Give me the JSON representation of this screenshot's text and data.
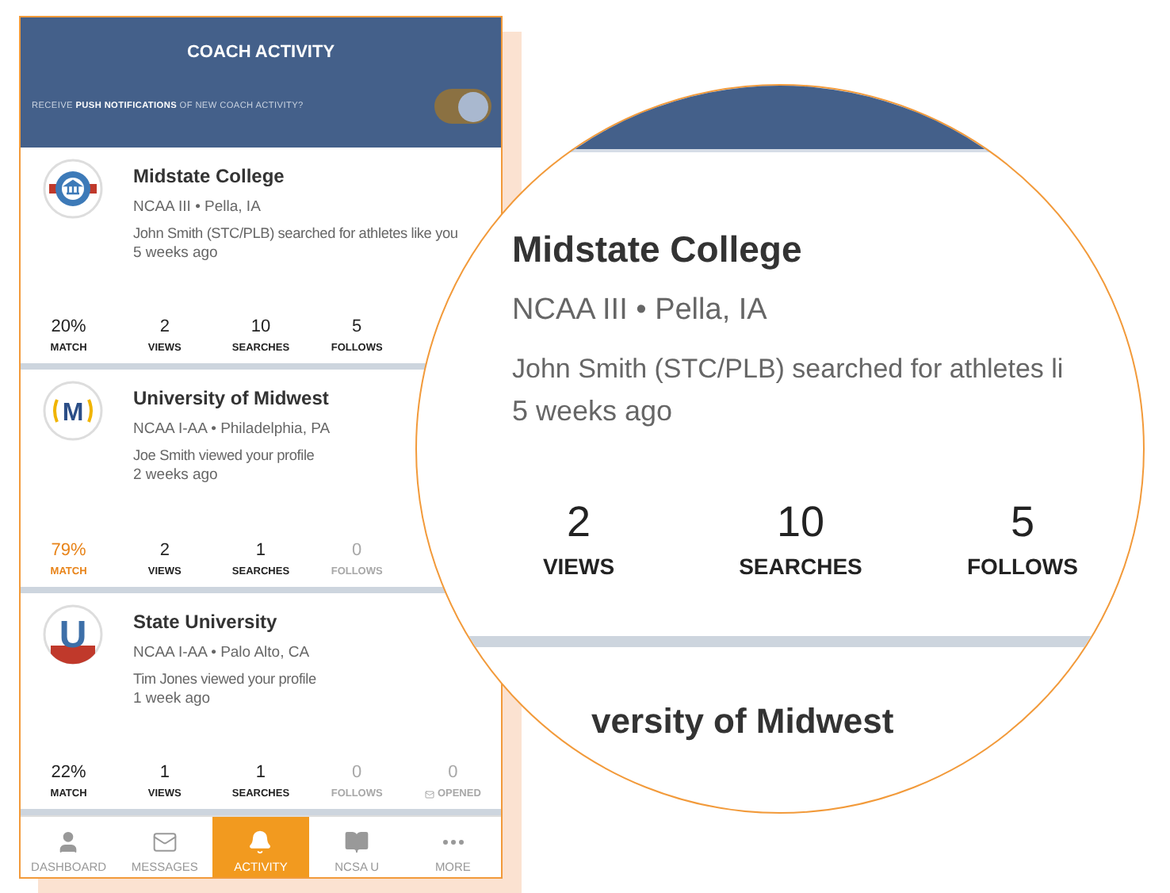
{
  "header": {
    "title": "COACH ACTIVITY",
    "push_prompt": "RECEIVE **PUSH NOTIFICATIONS** OF NEW COACH ACTIVITY?",
    "push_toggle": {
      "on": true
    }
  },
  "cards": [
    {
      "name": "Midstate College",
      "meta": "NCAA III • Pella, IA",
      "activity": "John Smith (STC/PLB) searched for athletes like you",
      "time": "5 weeks ago",
      "logo": {
        "kind": "building"
      },
      "stats": [
        {
          "kind": "count",
          "value": "20%",
          "label": "MATCH",
          "highlighted": false,
          "dimmed": false
        },
        {
          "kind": "count",
          "value": "2",
          "label": "VIEWS",
          "highlighted": false,
          "dimmed": false
        },
        {
          "kind": "count",
          "value": "10",
          "label": "SEARCHES",
          "highlighted": false,
          "dimmed": false
        },
        {
          "kind": "count",
          "value": "5",
          "label": "FOLLOWS",
          "highlighted": false,
          "dimmed": false
        }
      ]
    },
    {
      "name": "University of Midwest",
      "meta": "NCAA I-AA • Philadelphia, PA",
      "activity": "Joe Smith viewed your profile",
      "time": "2 weeks ago",
      "logo": {
        "kind": "letter",
        "letter": "M"
      },
      "stats": [
        {
          "kind": "count",
          "value": "79%",
          "label": "MATCH",
          "highlighted": true,
          "dimmed": false
        },
        {
          "kind": "count",
          "value": "2",
          "label": "VIEWS",
          "highlighted": false,
          "dimmed": false
        },
        {
          "kind": "count",
          "value": "1",
          "label": "SEARCHES",
          "highlighted": false,
          "dimmed": false
        },
        {
          "kind": "count",
          "value": "0",
          "label": "FOLLOWS",
          "highlighted": false,
          "dimmed": true
        }
      ]
    },
    {
      "name": "State University",
      "meta": "NCAA I-AA • Palo Alto, CA",
      "activity": "Tim Jones viewed your profile",
      "time": "1 week ago",
      "logo": {
        "kind": "shield",
        "letter": "U"
      },
      "stats": [
        {
          "kind": "count",
          "value": "22%",
          "label": "MATCH",
          "highlighted": false,
          "dimmed": false
        },
        {
          "kind": "count",
          "value": "1",
          "label": "VIEWS",
          "highlighted": false,
          "dimmed": false
        },
        {
          "kind": "count",
          "value": "1",
          "label": "SEARCHES",
          "highlighted": false,
          "dimmed": false
        },
        {
          "kind": "count",
          "value": "0",
          "label": "FOLLOWS",
          "highlighted": false,
          "dimmed": true
        },
        {
          "kind": "opened",
          "value": "0",
          "label": "OPENED",
          "highlighted": false,
          "dimmed": true
        }
      ]
    }
  ],
  "tab_bar": [
    {
      "label": "DASHBOARD",
      "selected": false
    },
    {
      "label": "MESSAGES",
      "selected": false
    },
    {
      "label": "ACTIVITY",
      "selected": true
    },
    {
      "label": "NCSA U",
      "selected": false
    },
    {
      "label": "MORE",
      "selected": false
    }
  ],
  "magnifier": {
    "name": "Midstate College",
    "meta": "NCAA III • Pella, IA",
    "activity": "John Smith (STC/PLB) searched for athletes li",
    "time": "5 weeks ago",
    "stats": [
      {
        "value": "2",
        "label": "VIEWS"
      },
      {
        "value": "10",
        "label": "SEARCHES"
      },
      {
        "value": "5",
        "label": "FOLLOWS"
      }
    ],
    "next_name": "versity of Midwest"
  }
}
